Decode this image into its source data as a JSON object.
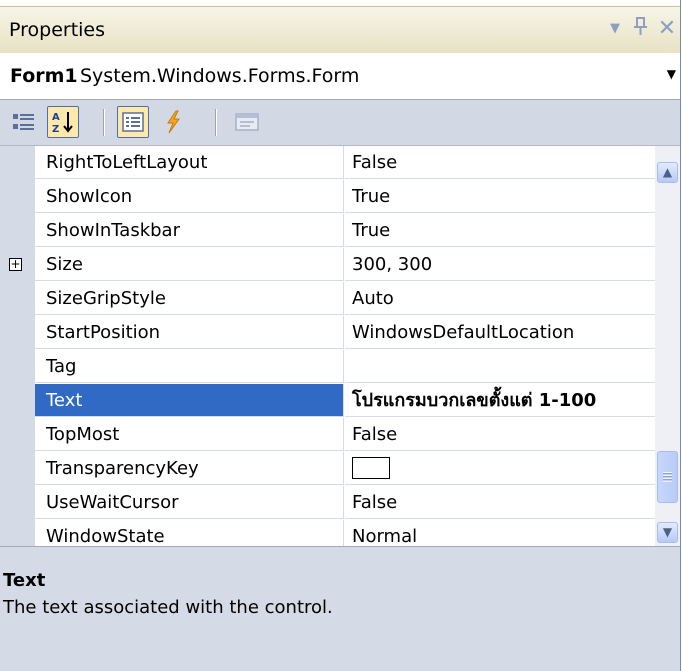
{
  "window": {
    "title": "Properties",
    "buttons": {
      "dropdown_icon": "chevron-down-icon",
      "pin_icon": "pin-icon",
      "close_icon": "close-icon",
      "dropdown_glyph": "▼",
      "pin_glyph": "ᵖ",
      "close_glyph": "✕"
    }
  },
  "selector": {
    "object_name": "Form1",
    "object_type": "System.Windows.Forms.Form",
    "chevron_glyph": "▼"
  },
  "toolbar": {
    "buttons": [
      {
        "name": "categorized",
        "icon": "categorized-icon",
        "active": false
      },
      {
        "name": "alphabetical",
        "icon": "sort-az-icon",
        "active": true
      },
      {
        "name": "properties",
        "icon": "properties-icon",
        "active": true
      },
      {
        "name": "events",
        "icon": "lightning-icon",
        "active": false
      },
      {
        "name": "property-pages",
        "icon": "property-pages-icon",
        "active": false
      }
    ]
  },
  "properties": [
    {
      "name": "RightToLeftLayout",
      "value": "False"
    },
    {
      "name": "ShowIcon",
      "value": "True"
    },
    {
      "name": "ShowInTaskbar",
      "value": "True"
    },
    {
      "name": "Size",
      "value": "300, 300",
      "expandable": true
    },
    {
      "name": "SizeGripStyle",
      "value": "Auto"
    },
    {
      "name": "StartPosition",
      "value": "WindowsDefaultLocation"
    },
    {
      "name": "Tag",
      "value": ""
    },
    {
      "name": "Text",
      "value": "โปรแกรมบวกเลขตั้งแต่ 1-100",
      "selected": true
    },
    {
      "name": "TopMost",
      "value": "False"
    },
    {
      "name": "TransparencyKey",
      "value": "",
      "color_swatch": "#ffffff"
    },
    {
      "name": "UseWaitCursor",
      "value": "False"
    },
    {
      "name": "WindowState",
      "value": "Normal"
    }
  ],
  "description": {
    "title": "Text",
    "text": "The text associated with the control."
  },
  "colors": {
    "selection": "#316ac5",
    "panel": "#d4dbe6",
    "titlebar": "#ece8cc"
  }
}
